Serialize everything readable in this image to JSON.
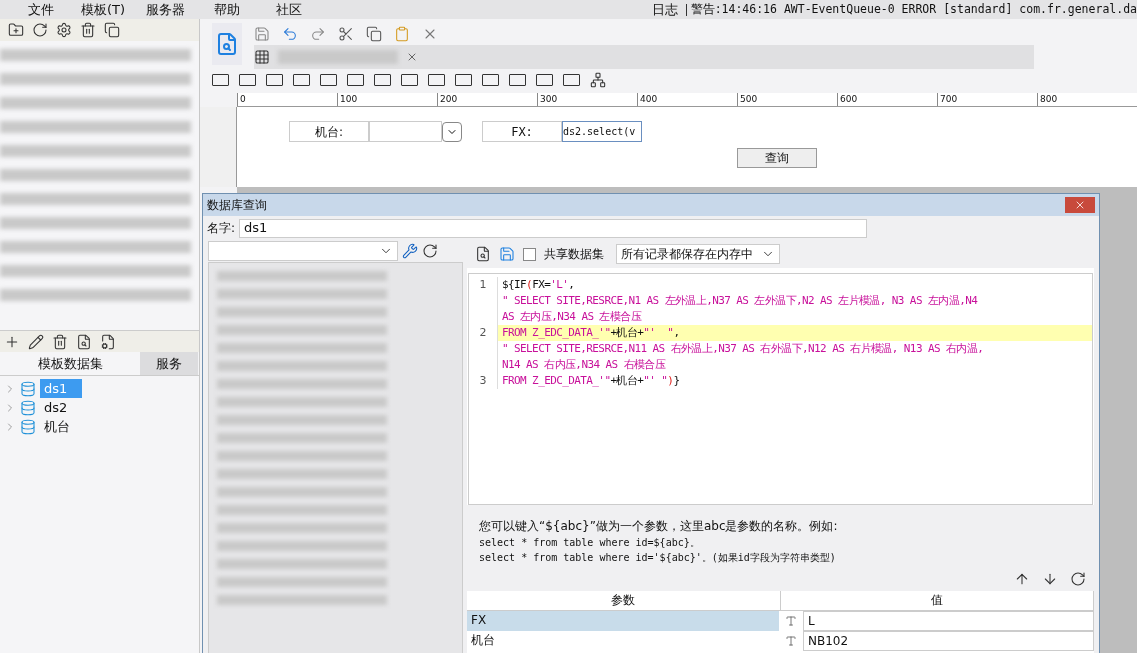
{
  "menu": [
    "文件",
    "模板(T)",
    "服务器",
    "帮助",
    "社区"
  ],
  "log": {
    "label": "日志",
    "message": "警告:14:46:16 AWT-EventQueue-0 ERROR [standard] com.fr.general.da"
  },
  "ruler": [
    "0",
    "100",
    "200",
    "300",
    "400",
    "500",
    "600",
    "700",
    "800"
  ],
  "form": {
    "label_1": "机台:",
    "label_2": "FX:",
    "value_2": "ds2.select(v",
    "button": "查询"
  },
  "left_tabs": [
    {
      "label": "模板数据集",
      "selected": true
    },
    {
      "label": "服务",
      "selected": false
    }
  ],
  "datasets": [
    {
      "name": "ds1",
      "selected": true
    },
    {
      "name": "ds2",
      "selected": false
    },
    {
      "name": "机台",
      "selected": false
    }
  ],
  "dialog": {
    "title": "数据库查询",
    "name_label": "名字:",
    "name_value": "ds1",
    "share": {
      "label": "共享数据集",
      "checked": false
    },
    "storage": "所有记录都保存在内存中",
    "code": [
      {
        "number": "1",
        "highlighted": false,
        "segments": [
          {
            "kind": "text",
            "text": "${IF"
          },
          {
            "kind": "paren",
            "text": "("
          },
          {
            "kind": "text",
            "text": "FX="
          },
          {
            "kind": "str",
            "text": "'L'"
          },
          {
            "kind": "text",
            "text": ","
          }
        ]
      },
      {
        "highlighted": false,
        "segments": [
          {
            "kind": "str",
            "text": "\" SELECT SITE,RESRCE,N1 AS 左外温上,N37 AS 左外温下,N2 AS 左片模温, N3 AS 左内温,N4"
          }
        ]
      },
      {
        "highlighted": false,
        "segments": [
          {
            "kind": "str",
            "text": "AS 左内压,N34 AS 左模合压"
          }
        ]
      },
      {
        "number": "2",
        "highlighted": true,
        "segments": [
          {
            "kind": "str",
            "text": "FROM Z_EDC_DATA_'\""
          },
          {
            "kind": "text",
            "text": "+机台+"
          },
          {
            "kind": "str",
            "text": "\"'  \""
          },
          {
            "kind": "text",
            "text": ","
          }
        ]
      },
      {
        "highlighted": false,
        "segments": [
          {
            "kind": "str",
            "text": "\" SELECT SITE,RESRCE,N11 AS 右外温上,N37 AS 右外温下,N12 AS 右片模温, N13 AS 右内温,"
          }
        ]
      },
      {
        "highlighted": false,
        "segments": [
          {
            "kind": "str",
            "text": "N14 AS 右内压,N34 AS 右模合压"
          }
        ]
      },
      {
        "number": "3",
        "highlighted": false,
        "segments": [
          {
            "kind": "str",
            "text": "FROM Z_EDC_DATA_'\""
          },
          {
            "kind": "text",
            "text": "+机台+"
          },
          {
            "kind": "str",
            "text": "\"' \""
          },
          {
            "kind": "paren",
            "text": ")"
          },
          {
            "kind": "text",
            "text": "}"
          }
        ]
      }
    ],
    "hint": [
      "您可以键入“${abc}”做为一个参数，这里abc是参数的名称。例如:",
      "select * from table where id=${abc}。",
      "select * from table where id='${abc}'。(如果id字段为字符串类型)"
    ],
    "params": {
      "columns": [
        "参数",
        "值"
      ],
      "rows": [
        {
          "name": "FX",
          "value": "L",
          "selected": true
        },
        {
          "name": "机台",
          "value": "NB102",
          "selected": false
        }
      ]
    }
  }
}
